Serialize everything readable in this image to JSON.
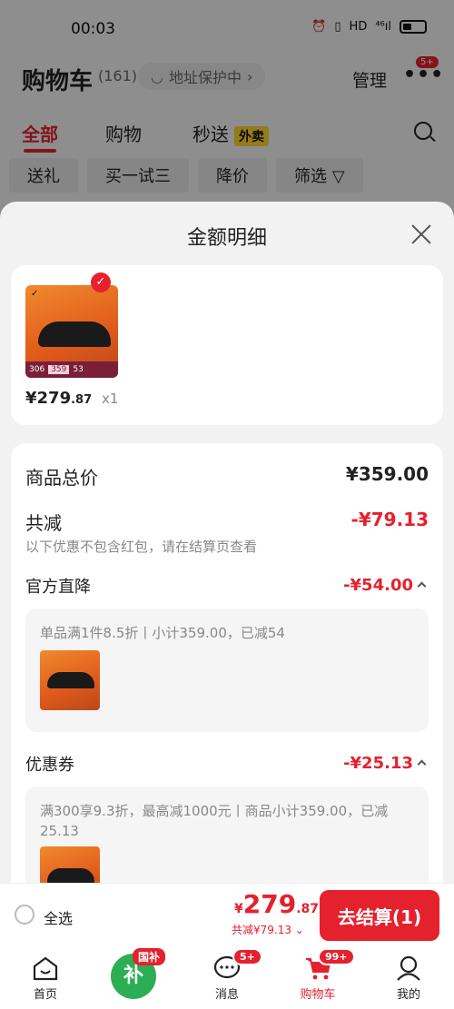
{
  "status_bar": {
    "time": "00:03",
    "icons": [
      "alarm-icon",
      "vibrate-icon",
      "hd-icon",
      "signal-icon",
      "battery-icon"
    ],
    "net_label": "HD",
    "signal_label": "⁴⁶ıl"
  },
  "cart_header": {
    "title": "购物车",
    "count": "(161)",
    "address_pill": "地址保护中",
    "manage": "管理",
    "more_badge": "5+"
  },
  "tabs": [
    {
      "label": "全部",
      "active": true
    },
    {
      "label": "购物",
      "active": false
    },
    {
      "label": "秒送",
      "active": false,
      "tag": "外卖"
    }
  ],
  "filters": [
    "送礼",
    "买一试三",
    "降价",
    "筛选 ▽"
  ],
  "sheet": {
    "title": "金额明细",
    "product": {
      "image_strip_left": "306",
      "image_strip_mid": "359",
      "image_strip_right": "53",
      "brand_mark": "✓",
      "price_int": "¥279",
      "price_dec": ".87",
      "qty": "x1"
    },
    "summary": {
      "total_label": "商品总价",
      "total_value": "¥359.00",
      "reduce_label": "共减",
      "reduce_value": "-¥79.13",
      "reduce_note": "以下优惠不包含红包，请在结算页查看",
      "official_label": "官方直降",
      "official_value": "-¥54.00",
      "official_detail": "单品满1件8.5折丨小计359.00，已减54",
      "coupon_label": "优惠券",
      "coupon_value": "-¥25.13",
      "coupon_detail": "满300享9.3折，最高减1000元丨商品小计359.00，已减25.13"
    }
  },
  "bottom_bar": {
    "select_all": "全选",
    "yen": "¥",
    "total_int": "279",
    "total_dec": ".87",
    "reduce_text": "共减¥79.13 ⌄",
    "checkout": "去结算(1)"
  },
  "tabbar": [
    {
      "label": "首页",
      "icon": "home-icon"
    },
    {
      "label": "",
      "icon": "subsidy-icon",
      "badge": "国补",
      "inner": "补"
    },
    {
      "label": "消息",
      "icon": "message-icon",
      "badge": "5+"
    },
    {
      "label": "购物车",
      "icon": "cart-icon",
      "badge": "99+",
      "active": true
    },
    {
      "label": "我的",
      "icon": "profile-icon"
    }
  ],
  "colors": {
    "accent": "#e4212d",
    "subsidy_green": "#2cae54",
    "tag_yellow": "#ffd62e"
  }
}
